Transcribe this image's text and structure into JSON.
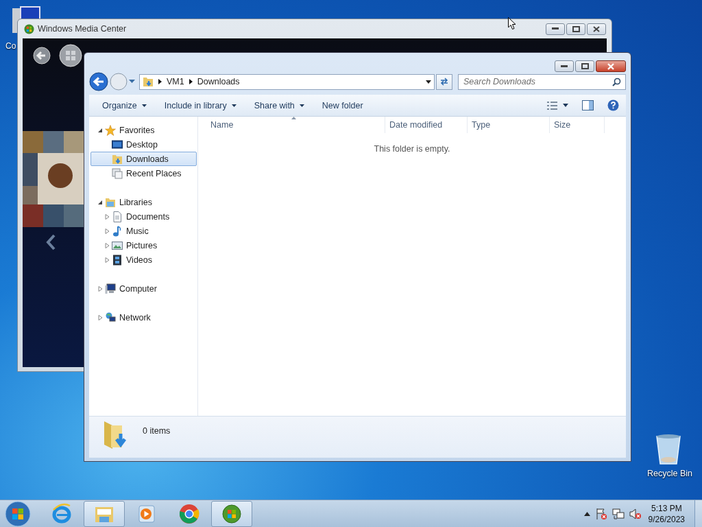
{
  "desktop": {
    "partial_icon_label": "Co",
    "recycle_bin_label": "Recycle Bin"
  },
  "media_center": {
    "title": "Windows Media Center"
  },
  "explorer": {
    "breadcrumb": [
      "VM1",
      "Downloads"
    ],
    "search": {
      "placeholder": "Search Downloads"
    },
    "commands": [
      {
        "label": "Organize",
        "dropdown": true
      },
      {
        "label": "Include in library",
        "dropdown": true
      },
      {
        "label": "Share with",
        "dropdown": true
      },
      {
        "label": "New folder",
        "dropdown": false
      }
    ],
    "nav": [
      {
        "label": "Favorites",
        "kind": "star",
        "expanded": true,
        "selected": false,
        "children": [
          {
            "label": "Desktop",
            "kind": "desktop",
            "selected": false
          },
          {
            "label": "Downloads",
            "kind": "downloads",
            "selected": true
          },
          {
            "label": "Recent Places",
            "kind": "recent",
            "selected": false
          }
        ]
      },
      {
        "label": "Libraries",
        "kind": "library",
        "expanded": true,
        "selected": false,
        "children": [
          {
            "label": "Documents",
            "kind": "documents",
            "expanded": false,
            "selected": false
          },
          {
            "label": "Music",
            "kind": "music",
            "expanded": false,
            "selected": false
          },
          {
            "label": "Pictures",
            "kind": "pictures",
            "expanded": false,
            "selected": false
          },
          {
            "label": "Videos",
            "kind": "videos",
            "expanded": false,
            "selected": false
          }
        ]
      },
      {
        "label": "Computer",
        "kind": "computer",
        "expanded": false,
        "selected": false
      },
      {
        "label": "Network",
        "kind": "network",
        "expanded": false,
        "selected": false
      }
    ],
    "columns": [
      {
        "label": "Name",
        "sorted": true
      },
      {
        "label": "Date modified",
        "sorted": false
      },
      {
        "label": "Type",
        "sorted": false
      },
      {
        "label": "Size",
        "sorted": false
      }
    ],
    "empty_message": "This folder is empty.",
    "status": "0 items"
  },
  "taskbar": {
    "apps": [
      {
        "kind": "browser",
        "active": false
      },
      {
        "kind": "explorer",
        "active": true
      },
      {
        "kind": "player",
        "active": false
      },
      {
        "kind": "chrome",
        "active": false
      },
      {
        "kind": "mediacenter",
        "active": true
      }
    ],
    "time": "5:13 PM",
    "date": "9/26/2023"
  }
}
